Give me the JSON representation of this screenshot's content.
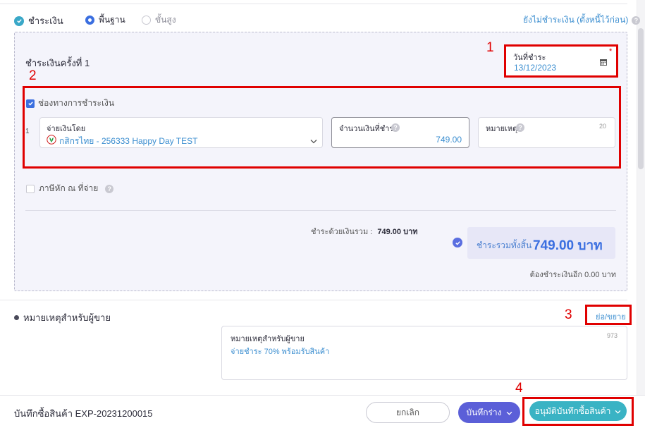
{
  "colors": {
    "accent": "#3b6fe0",
    "teal": "#3aa8c8",
    "annotation_red": "#e00000",
    "link": "#3b8ed0"
  },
  "payment_header": {
    "label": "ชำระเงิน",
    "mode_basic": "พื้นฐาน",
    "mode_advanced": "ขั้นสูง",
    "unpaid_link": "ยังไม่ชำระเงิน (ตั้งหนี้ไว้ก่อน)"
  },
  "installment": {
    "title": "ชำระเงินครั้งที่ 1",
    "date_label": "วันที่ชำระ",
    "date_value": "13/12/2023",
    "required_mark": "*"
  },
  "channel": {
    "checkbox_label": "ช่องทางการชำระเงิน",
    "row_index": "1",
    "pay_by_label": "จ่ายเงินโดย",
    "pay_by_value": "กสิกรไทย - 256333 Happy Day TEST",
    "amount_label": "จำนวนเงินที่ชำระ",
    "amount_value": "749.00",
    "note_label": "หมายเหตุ",
    "note_counter": "20"
  },
  "withholding": {
    "label": "ภาษีหัก ณ ที่จ่าย"
  },
  "summary": {
    "paid_label": "ชำระด้วยเงินรวม :",
    "paid_value": "749.00 บาท",
    "total_label": "ชำระรวมทั้งสิ้น",
    "total_value": "749.00 บาท",
    "remaining": "ต้องชำระเงินอีก 0.00 บาท"
  },
  "seller_note": {
    "title": "หมายเหตุสำหรับผู้ขาย",
    "toggle": "ย่อ/ขยาย",
    "field_label": "หมายเหตุสำหรับผู้ขาย",
    "counter": "973",
    "value": "จ่ายชำระ 70% พร้อมรับสินค้า"
  },
  "annotations": {
    "n1": "1",
    "n2": "2",
    "n3": "3",
    "n4": "4"
  },
  "footer": {
    "doc_title": "บันทึกซื้อสินค้า EXP-20231200015",
    "cancel": "ยกเลิก",
    "draft": "บันทึกร่าง",
    "approve": "อนุมัติบันทึกซื้อสินค้า"
  },
  "icons": [
    "check-circle-icon",
    "radio-icon",
    "help-icon",
    "calendar-icon",
    "checkbox-icon",
    "bank-logo-icon",
    "chevron-down-icon",
    "bullet-icon"
  ]
}
